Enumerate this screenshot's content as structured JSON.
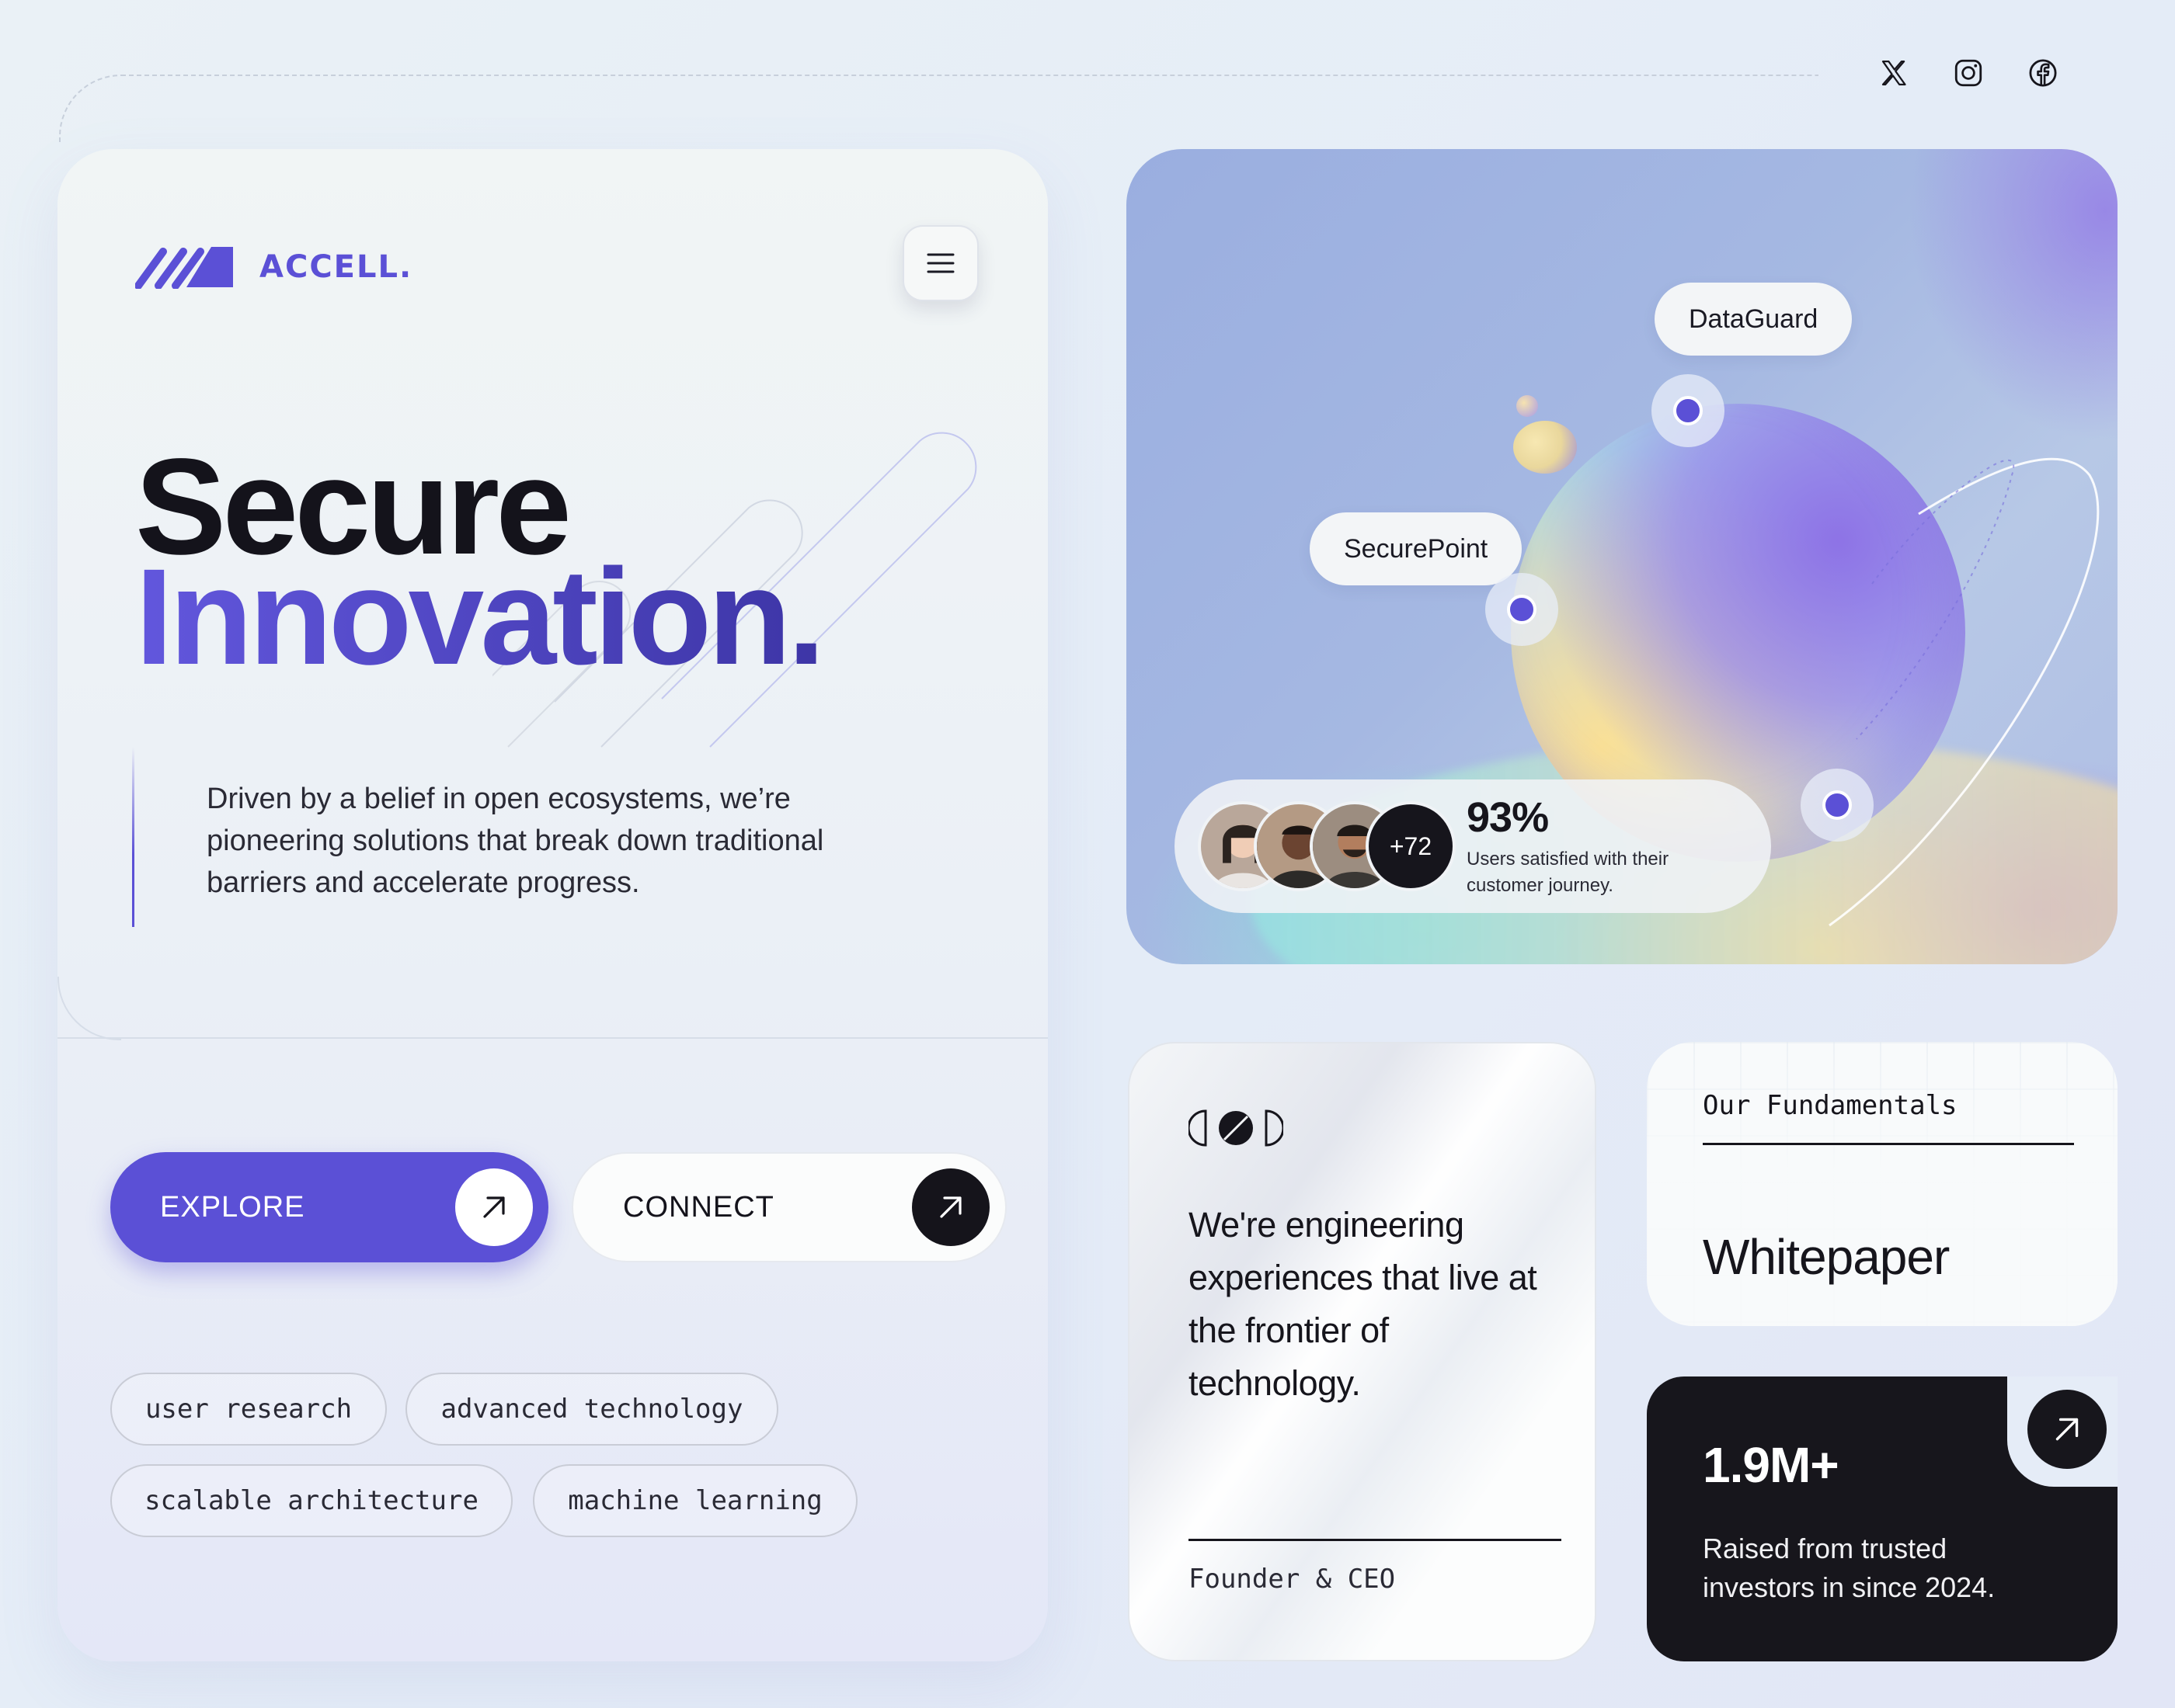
{
  "socials": [
    {
      "icon": "x-icon"
    },
    {
      "icon": "instagram-icon"
    },
    {
      "icon": "facebook-icon"
    }
  ],
  "brand": {
    "name": "ACCELL.",
    "color": "#5b50d6"
  },
  "hero": {
    "headline_line1": "Secure",
    "headline_line2": "Innovation.",
    "lead": "Driven by a belief in open ecosystems, we’re pioneering solutions that break down traditional barriers and accelerate progress."
  },
  "actions": {
    "explore_label": "EXPLORE",
    "connect_label": "CONNECT"
  },
  "tags": [
    "user research",
    "advanced technology",
    "scalable architecture",
    "machine learning"
  ],
  "visual": {
    "labels": [
      "DataGuard",
      "SecurePoint"
    ],
    "stats": {
      "extra_count": "+72",
      "value": "93%",
      "description": "Users satisfied with their customer journey."
    }
  },
  "quote": {
    "text": "We're engineering experiences that live at the frontier of technology.",
    "role": "Founder & CEO"
  },
  "whitepaper": {
    "kicker": "Our Fundamentals",
    "title": "Whitepaper"
  },
  "funding": {
    "value": "1.9M+",
    "description": "Raised from trusted investors in since 2024."
  },
  "colors": {
    "accent": "#5b50d6",
    "dark": "#17161c",
    "background": "#e5ecf7"
  }
}
